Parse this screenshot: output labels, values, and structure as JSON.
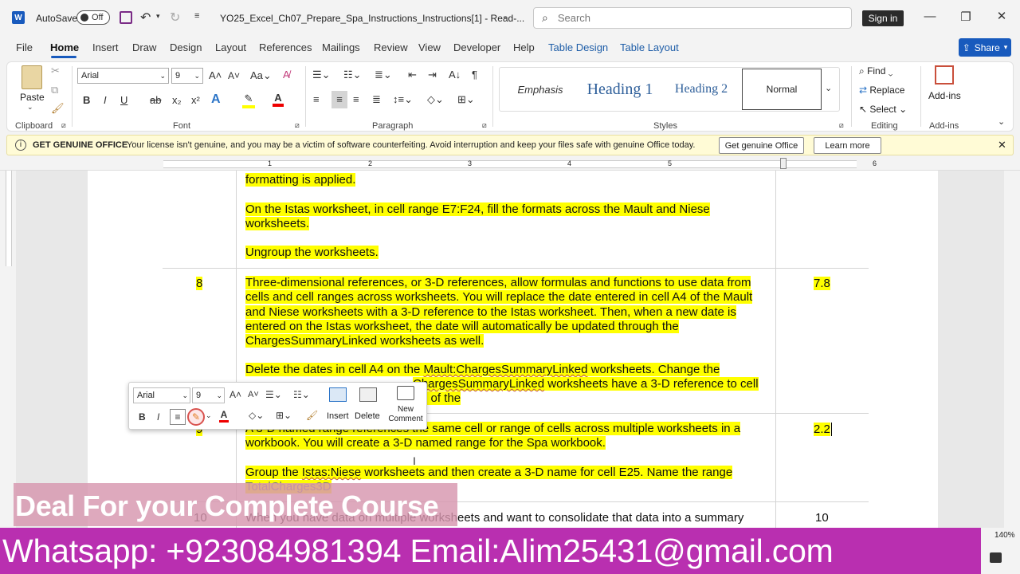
{
  "titlebar": {
    "autosave_label": "AutoSave",
    "autosave_state": "Off",
    "doc_title": "YO25_Excel_Ch07_Prepare_Spa_Instructions_Instructions[1]  -  Read-...",
    "search_placeholder": "Search",
    "signin_label": "Sign in"
  },
  "menu": {
    "tabs": [
      "File",
      "Home",
      "Insert",
      "Draw",
      "Design",
      "Layout",
      "References",
      "Mailings",
      "Review",
      "View",
      "Developer",
      "Help",
      "Table Design",
      "Table Layout"
    ],
    "active_tab": "Home",
    "share_label": "Share"
  },
  "ribbon": {
    "clipboard": {
      "paste_label": "Paste",
      "group_label": "Clipboard"
    },
    "font": {
      "font_name": "Arial",
      "font_size": "9",
      "group_label": "Font"
    },
    "paragraph": {
      "group_label": "Paragraph"
    },
    "styles": {
      "items": [
        "Emphasis",
        "Heading 1",
        "Heading 2",
        "Normal"
      ],
      "group_label": "Styles"
    },
    "editing": {
      "find_label": "Find",
      "replace_label": "Replace",
      "select_label": "Select",
      "group_label": "Editing"
    },
    "addins": {
      "addins_label": "Add-ins",
      "group_label": "Add-ins"
    }
  },
  "message_bar": {
    "title": "GET GENUINE OFFICE",
    "text": "Your license isn't genuine, and you may be a victim of software counterfeiting. Avoid interruption and keep your files safe with genuine Office today.",
    "btn_primary": "Get genuine Office",
    "btn_secondary": "Learn more"
  },
  "ruler": {
    "marks": [
      "1",
      "2",
      "3",
      "4",
      "5",
      "6"
    ]
  },
  "document": {
    "row7": {
      "p1": "formatting is applied.",
      "p2": "On the Istas worksheet, in cell range E7:F24, fill the formats across the Mault and Niese worksheets.",
      "p3": "Ungroup the worksheets."
    },
    "row8": {
      "step": "8",
      "points": "7.8",
      "p1": "Three-dimensional references, or 3-D references, allow formulas and functions to use data from cells and cell ranges across worksheets. You will replace the date entered in cell A4 of the Mault and Niese worksheets with a 3-D reference to the Istas worksheet. Then, when a new date is entered on the Istas worksheet, the date will automatically be updated through the ChargesSummaryLinked worksheets as well.",
      "p2a": "Delete the dates in cell A4 on the ",
      "p2b": "Mault:ChargesSummaryLinked",
      "p2c": " worksheets. Change the",
      "p2d": "ChargesSummaryLinked",
      "p2e": " worksheets have a 3-D reference to cell A4 of the"
    },
    "row9": {
      "step": "9",
      "points": "2.2",
      "p1": "A 3-D named range references the same cell or range of cells across multiple worksheets in a workbook. You will create a 3-D named range for the Spa workbook.",
      "p2a": "Group the ",
      "p2b": "Istas:Niese",
      "p2c": " worksheets and then create a 3-D name for cell E25. Name the range ",
      "p2d": "TotalCharges3D"
    },
    "row10": {
      "step": "10",
      "points": "10",
      "p1": "When you have data on multiple worksheets and want to consolidate that data into a summary"
    }
  },
  "mini_toolbar": {
    "font_name": "Arial",
    "font_size": "9",
    "insert_label": "Insert",
    "delete_label": "Delete",
    "new_comment_label": "New Comment"
  },
  "overlays": {
    "promo_line1": "Deal For your Complete Course",
    "promo_line2": "Whatsapp: +923084981394 Email:Alim25431@gmail.com",
    "zoom": "140%"
  },
  "colors": {
    "accent": "#185abd",
    "highlight": "#ffff00",
    "promo": "#b92fb0"
  }
}
